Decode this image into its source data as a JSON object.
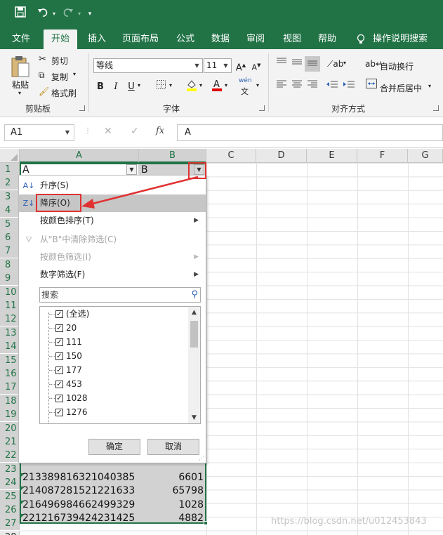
{
  "quick_access": {
    "save_icon": "save-icon",
    "undo_icon": "undo-icon",
    "redo_icon": "redo-icon",
    "customize_icon": "customize-icon"
  },
  "tabs": [
    "文件",
    "开始",
    "插入",
    "页面布局",
    "公式",
    "数据",
    "审阅",
    "视图",
    "帮助",
    "操作说明搜索"
  ],
  "active_tab": "开始",
  "ribbon": {
    "clipboard": {
      "paste": "粘贴",
      "cut": "剪切",
      "copy": "复制",
      "format_painter": "格式刷",
      "group": "剪贴板"
    },
    "font": {
      "font_name": "等线",
      "font_size": "11",
      "bold": "B",
      "italic": "I",
      "underline": "U",
      "group": "字体",
      "wen": "wén",
      "wen_char": "文"
    },
    "alignment": {
      "wrap_text": "自动换行",
      "merge_center": "合并后居中",
      "group": "对齐方式"
    }
  },
  "formula_bar": {
    "name_box": "A1",
    "cancel": "✕",
    "enter": "✓",
    "fx": "fx",
    "content": "A"
  },
  "columns": [
    "A",
    "B",
    "C",
    "D",
    "E",
    "F",
    "G"
  ],
  "rows": [
    "1",
    "2",
    "3",
    "4",
    "5",
    "6",
    "7",
    "8",
    "9",
    "10",
    "11",
    "12",
    "13",
    "14",
    "15",
    "16",
    "17",
    "18",
    "19",
    "20",
    "21",
    "22",
    "23",
    "24",
    "25",
    "26",
    "27",
    "28"
  ],
  "header_cells": {
    "a1": "A",
    "b1": "B"
  },
  "data_rows": [
    {
      "a": "213389816321040385",
      "b": "6601"
    },
    {
      "a": "214087281521221633",
      "b": "65798"
    },
    {
      "a": "216496984662499329",
      "b": "1028"
    },
    {
      "a": "221216739424231425",
      "b": "4882"
    }
  ],
  "filter_menu": {
    "sort_asc": "升序(S)",
    "sort_desc": "降序(O)",
    "sort_color": "按颜色排序(T)",
    "clear_filter": "从\"B\"中清除筛选(C)",
    "filter_color": "按颜色筛选(I)",
    "number_filter": "数字筛选(F)",
    "search_placeholder": "搜索",
    "items": [
      "(全选)",
      "20",
      "111",
      "150",
      "177",
      "453",
      "1028",
      "1276"
    ],
    "ok": "确定",
    "cancel": "取消"
  },
  "watermark": "https://blog.csdn.net/u012453843"
}
